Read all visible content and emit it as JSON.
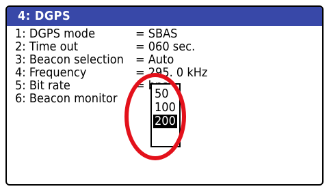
{
  "screen": {
    "title": "4: DGPS"
  },
  "settings": [
    {
      "label": "1: DGPS mode",
      "value": "= SBAS"
    },
    {
      "label": "2: Time out",
      "value": "= 060 sec."
    },
    {
      "label": "3: Beacon selection",
      "value": "= Auto"
    },
    {
      "label": "4: Frequency",
      "value": "= 295. 0 kHz"
    },
    {
      "label": "5: Bit rate",
      "value": "=     bps"
    },
    {
      "label": "6: Beacon monitor",
      "value": ""
    }
  ],
  "bitrate_dropdown": {
    "options": [
      "50",
      "100",
      "200"
    ],
    "selected": "200"
  },
  "colors": {
    "title_bar": "#3848a8",
    "highlight_ring": "#e3111b"
  }
}
